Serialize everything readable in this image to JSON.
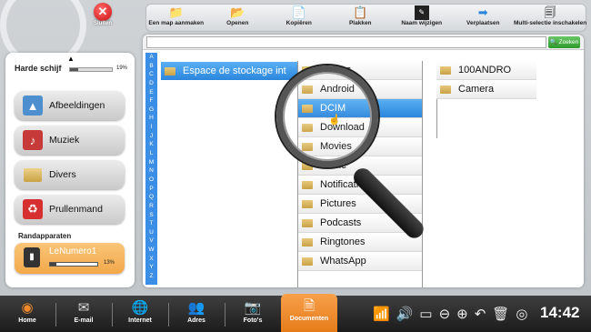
{
  "window": {
    "close_label": "Sluiten"
  },
  "toolbar": {
    "items": [
      {
        "label": "Een map aanmaken",
        "icon": "new-folder-icon"
      },
      {
        "label": "Openen",
        "icon": "open-folder-icon"
      },
      {
        "label": "Kopiëren",
        "icon": "copy-icon"
      },
      {
        "label": "Plakken",
        "icon": "paste-icon"
      },
      {
        "label": "Naam wijzigen",
        "icon": "rename-icon"
      },
      {
        "label": "Verplaatsen",
        "icon": "move-icon"
      },
      {
        "label": "Multi-selectie inschakelen",
        "icon": "multi-select-icon"
      }
    ]
  },
  "sidebar": {
    "storage_label": "Harde schijf",
    "storage_percent": "19%",
    "storage_fraction": 0.19,
    "categories": [
      {
        "label": "Afbeeldingen",
        "icon": "pictures-icon"
      },
      {
        "label": "Muziek",
        "icon": "music-icon"
      },
      {
        "label": "Divers",
        "icon": "folder-icon"
      },
      {
        "label": "Prullenmand",
        "icon": "trash-icon"
      }
    ],
    "devices_label": "Randapparaten",
    "device": {
      "name": "LeNumero1",
      "percent": "13%",
      "fraction": 0.13
    }
  },
  "search": {
    "value": "",
    "button_label": "Zoeken"
  },
  "alphabet": [
    "A",
    "B",
    "C",
    "D",
    "E",
    "F",
    "G",
    "H",
    "I",
    "J",
    "K",
    "L",
    "M",
    "N",
    "O",
    "P",
    "Q",
    "R",
    "S",
    "T",
    "U",
    "V",
    "W",
    "X",
    "Y",
    "Z"
  ],
  "columns": {
    "col1": {
      "selected": "Espace de stockage int"
    },
    "col2": [
      "Alarms",
      "Android",
      "DCIM",
      "Download",
      "Movies",
      "Music",
      "Notifications",
      "Pictures",
      "Podcasts",
      "Ringtones",
      "WhatsApp"
    ],
    "col2_selected_index": 2,
    "col3": [
      "100ANDRO",
      "Camera"
    ]
  },
  "bottom_nav": [
    {
      "label": "Home",
      "icon": "home-icon"
    },
    {
      "label": "E-mail",
      "icon": "email-icon"
    },
    {
      "label": "Internet",
      "icon": "globe-icon"
    },
    {
      "label": "Adres",
      "icon": "contacts-icon"
    },
    {
      "label": "Foto's",
      "icon": "camera-icon"
    },
    {
      "label": "Documenten",
      "icon": "documents-icon"
    }
  ],
  "status": {
    "time": "14:42"
  },
  "colors": {
    "accent_blue": "#2b86dc",
    "active_orange": "#e77b1a",
    "search_green": "#2e9a2e"
  }
}
